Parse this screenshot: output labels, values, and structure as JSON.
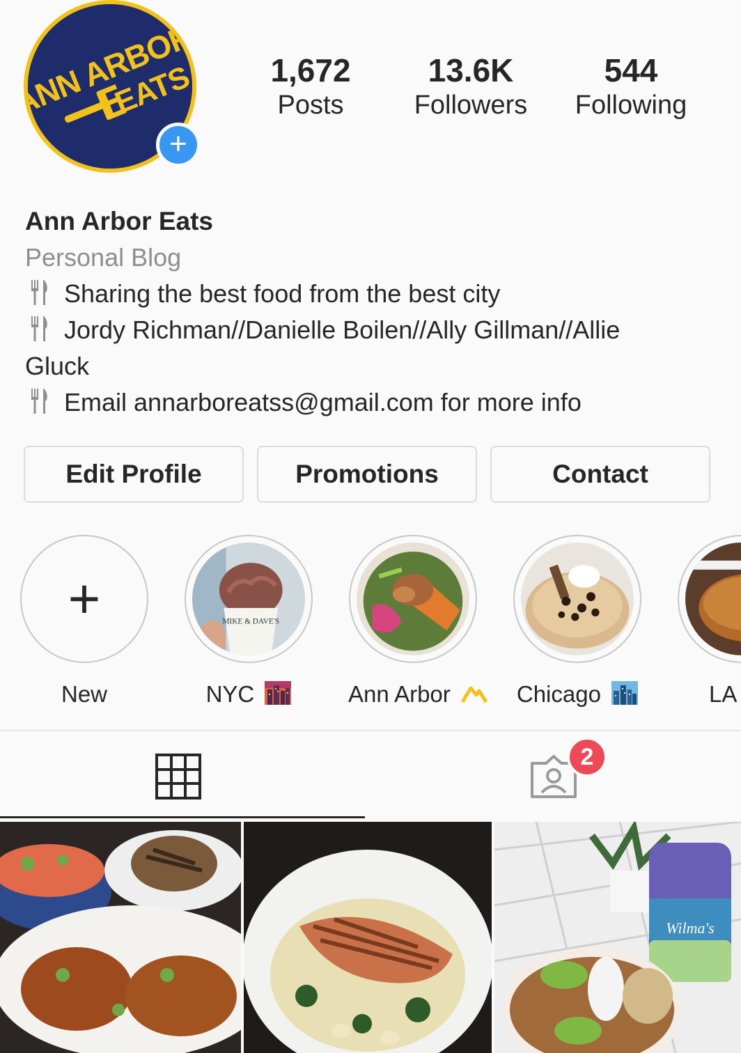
{
  "profile": {
    "avatar_icon": "ann-arbor-eats-logo",
    "logo_text_top": "ANN ARBOR",
    "logo_text_bottom": "EATS",
    "add_story_symbol": "+",
    "stats": {
      "posts_value": "1,672",
      "posts_label": "Posts",
      "followers_value": "13.6K",
      "followers_label": "Followers",
      "following_value": "544",
      "following_label": "Following"
    }
  },
  "bio": {
    "name": "Ann Arbor Eats",
    "category": "Personal Blog",
    "line1": "Sharing the best food from the best city",
    "line2": "Jordy Richman//Danielle Boilen//Ally Gillman//Allie",
    "line2_cont": "Gluck",
    "line3": "Email annarboreatss@gmail.com for more info",
    "bullet_icon": "fork-and-knife-icon"
  },
  "buttons": {
    "edit_profile": "Edit Profile",
    "promotions": "Promotions",
    "contact": "Contact"
  },
  "highlights": [
    {
      "label": "New",
      "icon": "plus-icon"
    },
    {
      "label": "NYC",
      "icon": "city-sunset-emoji"
    },
    {
      "label": "Ann Arbor",
      "icon": "mountain-emoji"
    },
    {
      "label": "Chicago",
      "icon": "cityscape-emoji"
    },
    {
      "label": "LA",
      "icon": ""
    }
  ],
  "highlight_texts": {
    "cup_text": "MIKE & DAVE'S"
  },
  "tabs": {
    "grid_icon": "grid-icon",
    "tagged_icon": "tagged-photos-icon",
    "tagged_badge": "2"
  },
  "photos": {
    "photo3_text": "Wilma's"
  },
  "colors": {
    "accent_blue": "#3897f0",
    "badge_red": "#ed4956",
    "logo_navy": "#1e2c6b",
    "logo_yellow": "#f2c21b"
  }
}
